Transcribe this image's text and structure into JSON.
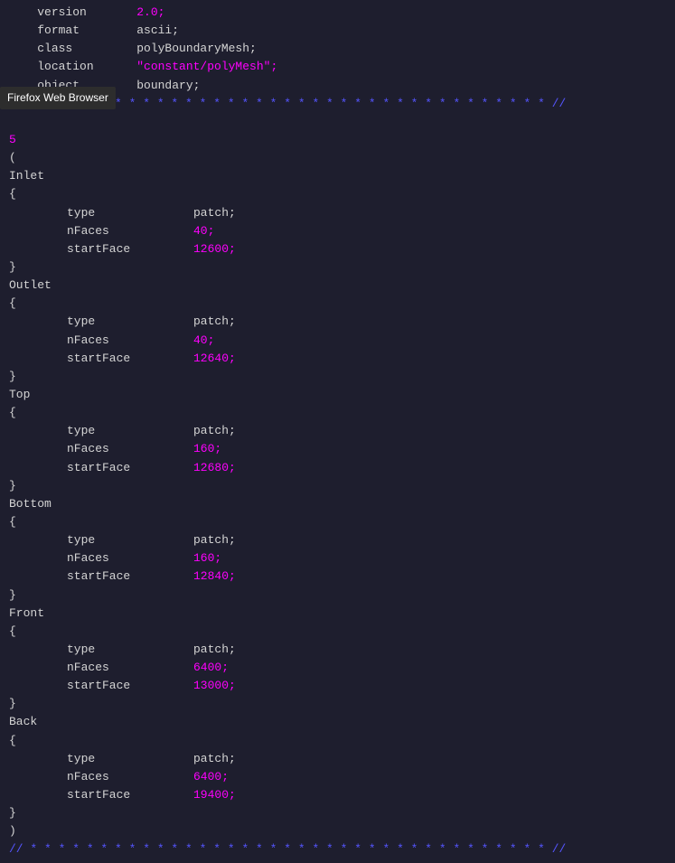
{
  "tooltip": "Firefox Web Browser",
  "header": {
    "version_key": "version",
    "version_val": "2.0;",
    "format_key": "format",
    "format_val": "ascii;",
    "class_key": "class",
    "class_val": "polyBoundaryMesh;",
    "location_key": "location",
    "location_val": "\"constant/polyMesh\";",
    "object_key": "object",
    "object_val": "boundary;"
  },
  "star_line": "// * * * * * * * * * * * * * * * * * * * * * * * * * * * * * * * * * * * * * //",
  "star_line_bottom": "// * * * * * * * * * * * * * * * * * * * * * * * * * * * * * * * * * * * * * //",
  "count": "5",
  "open_brace": "(",
  "close_brace": ")",
  "patches": [
    {
      "name": "Inlet",
      "type_val": "patch;",
      "nFaces_val": "40;",
      "startFace_val": "12600;"
    },
    {
      "name": "Outlet",
      "type_val": "patch;",
      "nFaces_val": "40;",
      "startFace_val": "12640;"
    },
    {
      "name": "Top",
      "type_val": "patch;",
      "nFaces_val": "160;",
      "startFace_val": "12680;"
    },
    {
      "name": "Bottom",
      "type_val": "patch;",
      "nFaces_val": "160;",
      "startFace_val": "12840;"
    },
    {
      "name": "Front",
      "type_val": "patch;",
      "nFaces_val": "6400;",
      "startFace_val": "13000;"
    },
    {
      "name": "Back",
      "type_val": "patch;",
      "nFaces_val": "6400;",
      "startFace_val": "19400;"
    }
  ]
}
